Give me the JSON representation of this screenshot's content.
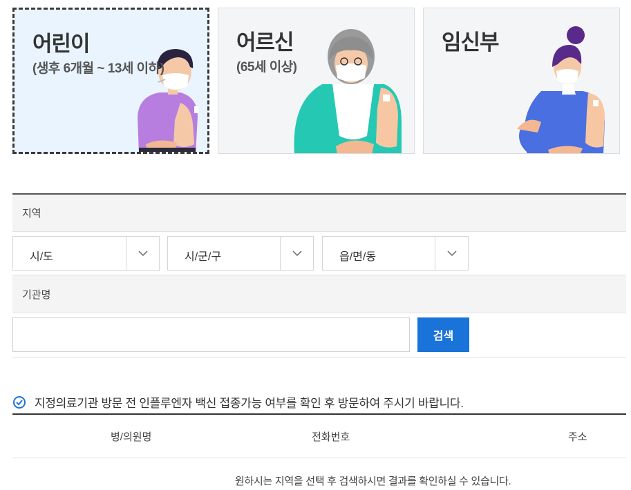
{
  "categories": [
    {
      "title": "어린이",
      "subtitle": "(생후 6개월 ~ 13세 이하)",
      "selected": true
    },
    {
      "title": "어르신",
      "subtitle": "(65세 이상)",
      "selected": false
    },
    {
      "title": "임신부",
      "subtitle": "",
      "selected": false
    }
  ],
  "region": {
    "label": "지역",
    "selects": [
      {
        "value": "시/도",
        "icon": "chevron-down-icon"
      },
      {
        "value": "시/군/구",
        "icon": "chevron-down-icon"
      },
      {
        "value": "읍/면/동",
        "icon": "chevron-down-icon"
      }
    ]
  },
  "institution": {
    "label": "기관명",
    "input_value": "",
    "placeholder": "",
    "search_label": "검색"
  },
  "notice": {
    "icon": "check-circle-icon",
    "text": "지정의료기관 방문 전 인플루엔자 백신 접종가능 여부를 확인 후 방문하여 주시기 바랍니다."
  },
  "table": {
    "headers": [
      "병/의원명",
      "전화번호",
      "주소"
    ],
    "empty_message": "원하시는 지역을 선택 후 검색하시면 결과를 확인하실 수 있습니다."
  },
  "colors": {
    "accent": "#1a73d9",
    "selected_card_bg": "#eaf4ff",
    "card_bg": "#f4f5f7"
  }
}
